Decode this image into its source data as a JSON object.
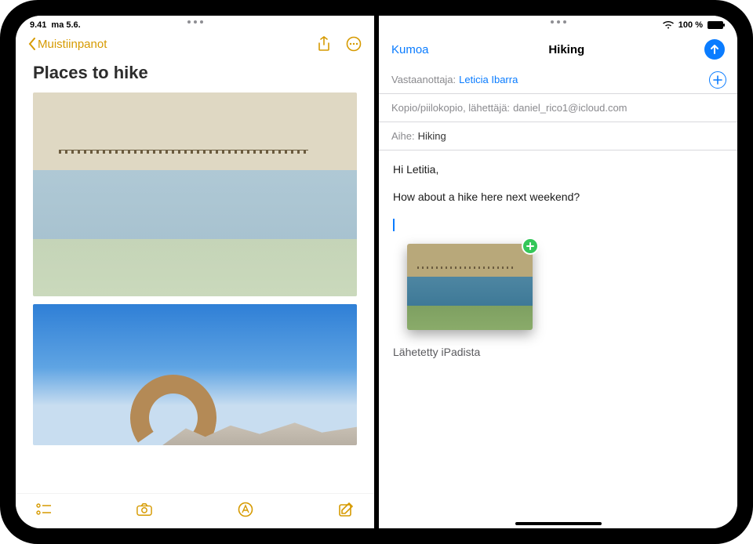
{
  "status": {
    "time": "9.41",
    "date": "ma 5.6.",
    "battery_pct": "100 %"
  },
  "notes": {
    "back_label": "Muistiinpanot",
    "title": "Places to hike"
  },
  "mail": {
    "cancel_label": "Kumoa",
    "title": "Hiking",
    "to_label": "Vastaanottaja:",
    "to_value": "Leticia Ibarra",
    "cc_label": "Kopio/piilokopio, lähettäjä:",
    "cc_value": "daniel_rico1@icloud.com",
    "subject_label": "Aihe:",
    "subject_value": "Hiking",
    "body_greeting": "Hi Letitia,",
    "body_line": "How about a hike here next weekend?",
    "signature": "Lähetetty iPadista"
  }
}
